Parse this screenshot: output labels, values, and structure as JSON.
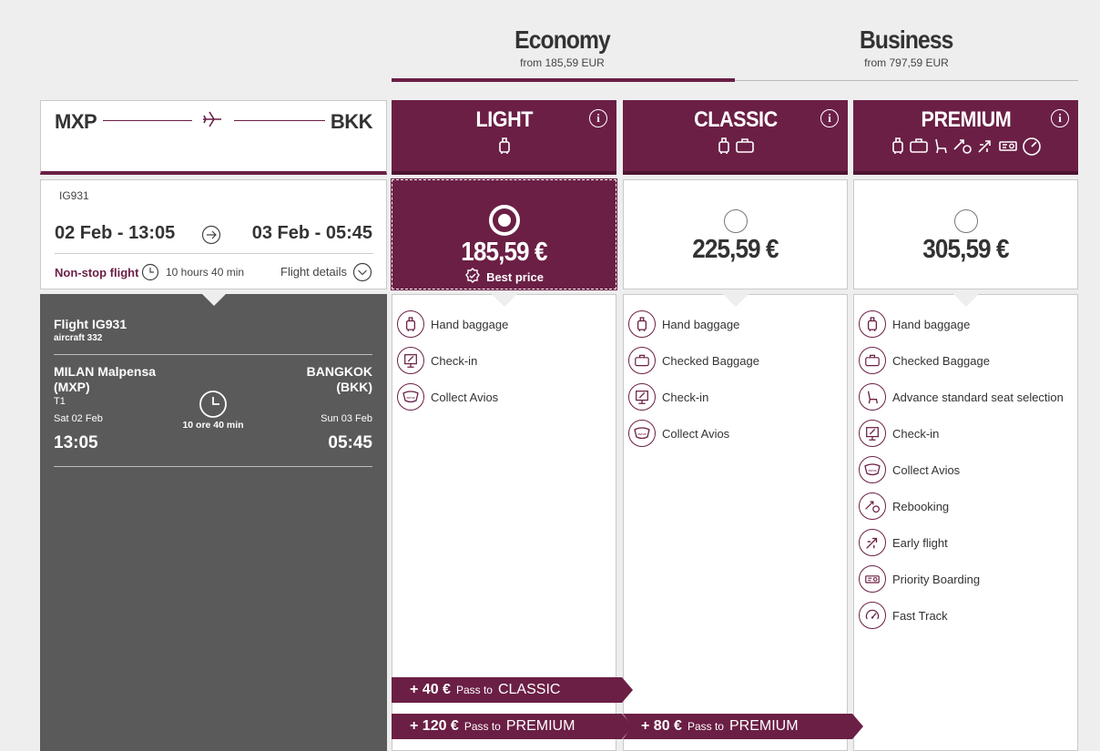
{
  "cabin_tabs": [
    {
      "name": "Economy",
      "from": "from 185,59 EUR",
      "active": true
    },
    {
      "name": "Business",
      "from": "from 797,59 EUR",
      "active": false
    }
  ],
  "route": {
    "origin": "MXP",
    "destination": "BKK"
  },
  "fares": [
    {
      "name": "LIGHT",
      "price": "185,59 €",
      "selected": true,
      "best_label": "Best price",
      "features": [
        {
          "label": "Hand baggage",
          "icon": "hand-baggage-icon"
        },
        {
          "label": "Check-in",
          "icon": "check-in-icon"
        },
        {
          "label": "Collect Avios",
          "icon": "avios-icon"
        }
      ]
    },
    {
      "name": "CLASSIC",
      "price": "225,59 €",
      "selected": false,
      "features": [
        {
          "label": "Hand baggage",
          "icon": "hand-baggage-icon"
        },
        {
          "label": "Checked Baggage",
          "icon": "checked-baggage-icon"
        },
        {
          "label": "Check-in",
          "icon": "check-in-icon"
        },
        {
          "label": "Collect Avios",
          "icon": "avios-icon"
        }
      ]
    },
    {
      "name": "PREMIUM",
      "price": "305,59 €",
      "selected": false,
      "features": [
        {
          "label": "Hand baggage",
          "icon": "hand-baggage-icon"
        },
        {
          "label": "Checked Baggage",
          "icon": "checked-baggage-icon"
        },
        {
          "label": "Advance standard seat selection",
          "icon": "seat-icon"
        },
        {
          "label": "Check-in",
          "icon": "check-in-icon"
        },
        {
          "label": "Collect Avios",
          "icon": "avios-icon"
        },
        {
          "label": "Rebooking",
          "icon": "rebooking-icon"
        },
        {
          "label": "Early flight",
          "icon": "early-flight-icon"
        },
        {
          "label": "Priority Boarding",
          "icon": "priority-boarding-icon"
        },
        {
          "label": "Fast Track",
          "icon": "fast-track-icon"
        }
      ]
    }
  ],
  "flight": {
    "number": "IG931",
    "departure": "02 Feb - 13:05",
    "arrival": "03 Feb - 05:45",
    "nonstop": "Non-stop flight",
    "duration": "10 hours 40 min",
    "details_link": "Flight details"
  },
  "details": {
    "title": "Flight IG931",
    "aircraft": "aircraft 332",
    "origin_city": "MILAN Malpensa",
    "origin_code": "(MXP)",
    "terminal": "T1",
    "dep_date": "Sat 02 Feb",
    "dep_time": "13:05",
    "dest_city": "BANGKOK",
    "dest_code": "(BKK)",
    "arr_date": "Sun 03 Feb",
    "arr_time": "05:45",
    "duration": "10 ore 40 min"
  },
  "upgrades": [
    {
      "amount": "+ 40 €",
      "pass": "Pass to",
      "target": "CLASSIC"
    },
    {
      "amount": "+ 120 €",
      "pass": "Pass to",
      "target": "PREMIUM"
    },
    {
      "amount": "+ 80 €",
      "pass": "Pass to",
      "target": "PREMIUM"
    }
  ],
  "colors": {
    "brand": "#6b1f45",
    "panel": "#5a5a5a",
    "background": "#eeeeee"
  }
}
